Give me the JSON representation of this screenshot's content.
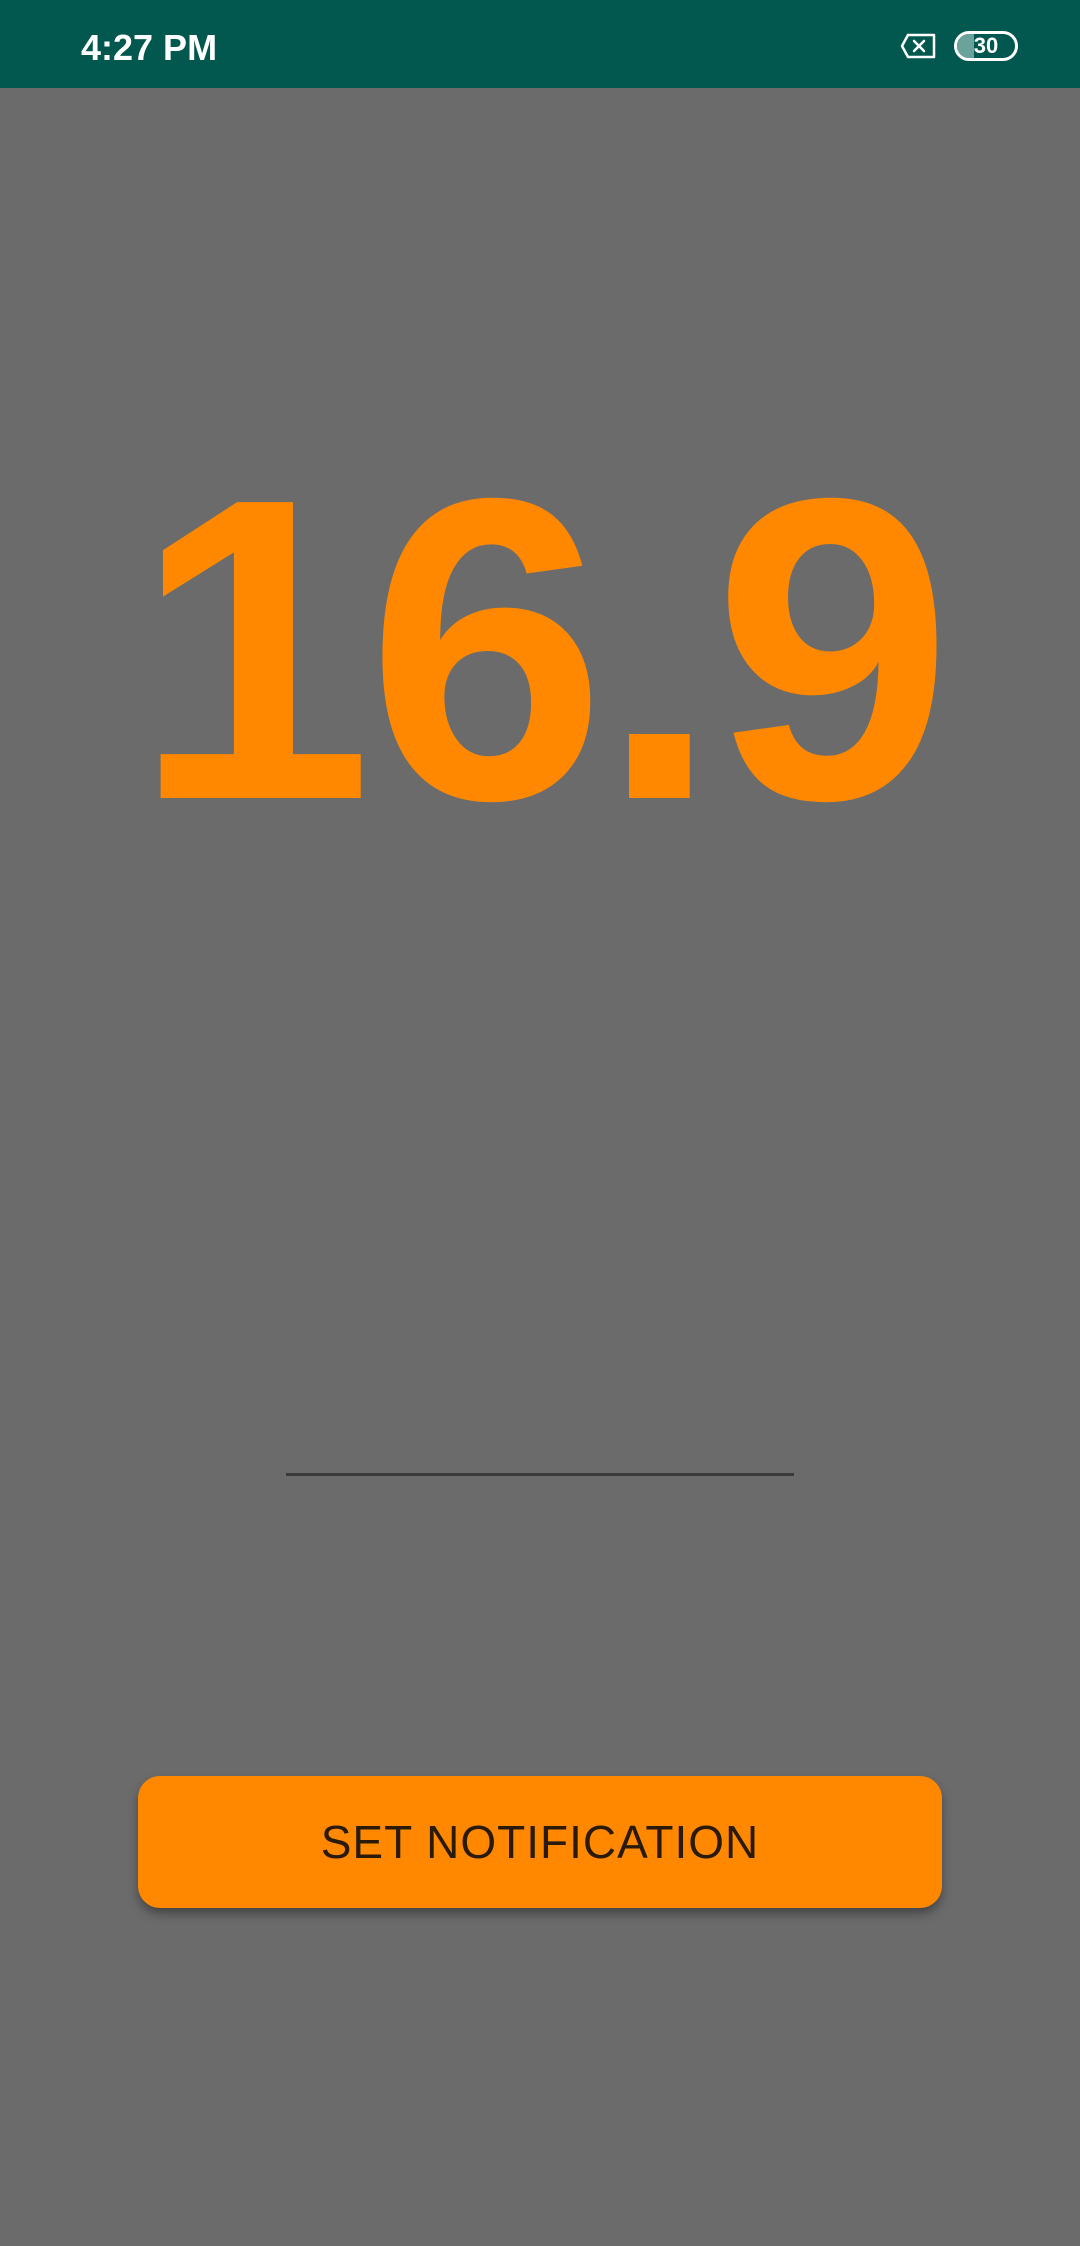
{
  "status_bar": {
    "time": "4:27 PM",
    "battery_level": "30",
    "battery_fraction": 0.3,
    "icons": [
      "sim-off-icon",
      "battery-icon"
    ],
    "background_color": "#02584e"
  },
  "main": {
    "value": "16.9",
    "value_color": "#ff8800",
    "input_value": "",
    "background_color": "#6b6b6b"
  },
  "actions": {
    "set_notification_label": "SET NOTIFICATION",
    "button_color": "#ff8800"
  }
}
